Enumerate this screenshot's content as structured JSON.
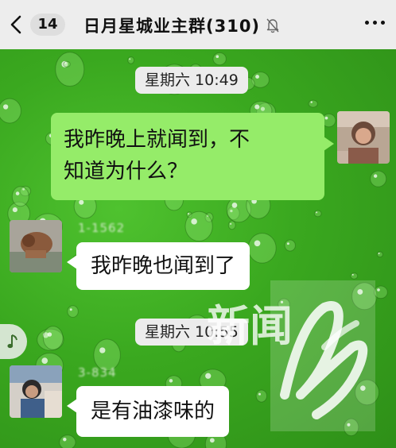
{
  "header": {
    "back_icon": "chevron-left-icon",
    "unread_count": "14",
    "title": "日月星城业主群(310)",
    "mute_icon": "bell-slash-icon",
    "more_icon": "more-dots-icon"
  },
  "messages": [
    {
      "type": "time",
      "text": "星期六 10:49"
    },
    {
      "type": "text",
      "from": "me",
      "lines": [
        "我昨晚上就闻到，不",
        "知道为什么？"
      ]
    },
    {
      "type": "text",
      "from": "other",
      "text": "我昨晚也闻到了"
    },
    {
      "type": "time",
      "text": "星期六 10:55"
    },
    {
      "type": "text",
      "from": "other",
      "text": "是有油漆味的"
    }
  ],
  "floating": {
    "music_icon": "music-note-icon"
  },
  "watermark": {
    "text": "新闻"
  },
  "colors": {
    "header_bg": "#ededed",
    "chat_bg": "#3aa81f",
    "bubble_self": "#95ec69",
    "bubble_other": "#ffffff",
    "timestamp_bg": "#ececec"
  }
}
